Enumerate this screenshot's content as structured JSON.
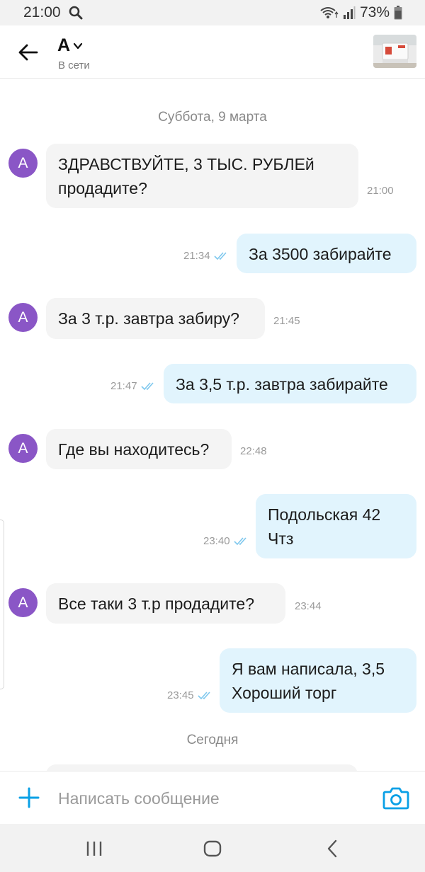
{
  "status_bar": {
    "time": "21:00",
    "battery": "73%"
  },
  "header": {
    "contact_name": "А",
    "contact_status": "В сети"
  },
  "chat": {
    "date_separators": [
      "Суббота, 9 марта",
      "Сегодня"
    ],
    "avatar_letter": "А",
    "messages": [
      {
        "direction": "in",
        "text": "ЗДРАВСТВУЙТЕ, 3 ТЫС. РУБЛЕй\nпродадите?",
        "time": "21:00"
      },
      {
        "direction": "out",
        "text": "За 3500 забирайте",
        "time": "21:34"
      },
      {
        "direction": "in",
        "text": "За 3 т.р. завтра забиру?",
        "time": "21:45"
      },
      {
        "direction": "out",
        "text": "За 3,5 т.р. завтра забирайте",
        "time": "21:47"
      },
      {
        "direction": "in",
        "text": "Где вы находитесь?",
        "time": "22:48"
      },
      {
        "direction": "out",
        "text": "Подольская 42\nЧтз",
        "time": "23:40"
      },
      {
        "direction": "in",
        "text": "Все таки 3 т.р продадите?",
        "time": "23:44"
      },
      {
        "direction": "out",
        "text": "Я вам написала, 3,5\nХороший торг",
        "time": "23:45"
      }
    ]
  },
  "compose": {
    "placeholder": "Написать сообщение"
  },
  "colors": {
    "accent": "#0aa0e6",
    "avatar": "#8a56c6",
    "incoming_bubble": "#f4f4f4",
    "outgoing_bubble": "#e1f4fd",
    "read_ticks": "#7fc8ee"
  }
}
